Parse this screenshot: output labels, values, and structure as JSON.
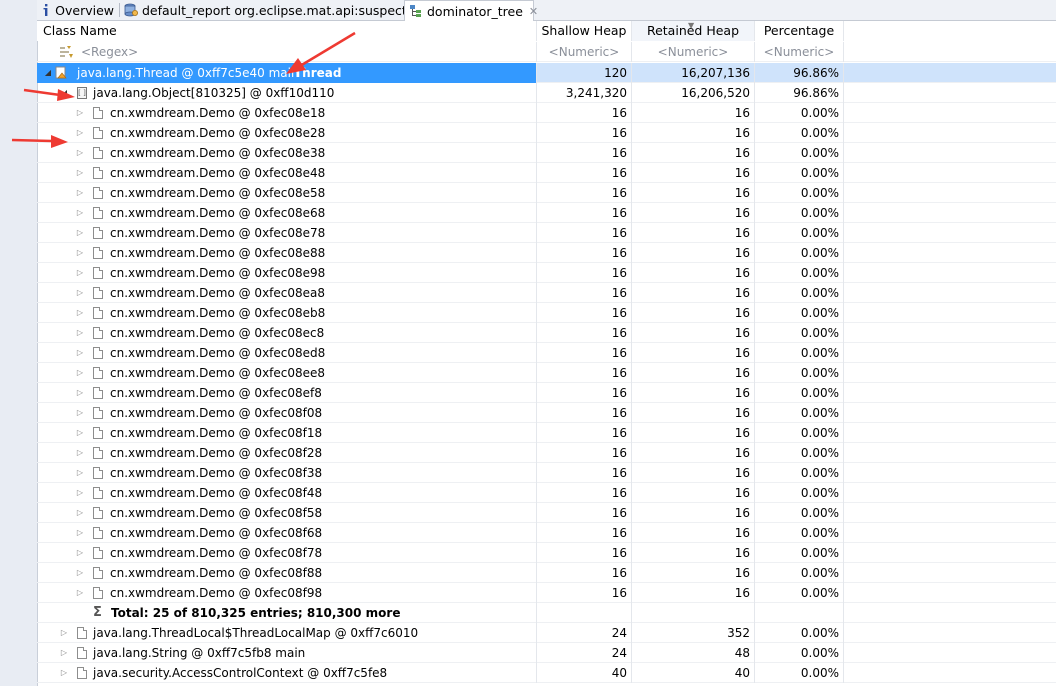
{
  "tabs": [
    {
      "icon": "info-icon",
      "label": "Overview"
    },
    {
      "icon": "report-icon",
      "label": "default_report  org.eclipse.mat.api:suspects"
    },
    {
      "icon": "tree-icon",
      "label": "dominator_tree",
      "active": true
    }
  ],
  "columns": {
    "class_name": "Class Name",
    "shallow": "Shallow Heap",
    "retained": "Retained Heap",
    "percentage": "Percentage"
  },
  "filter": {
    "class_name": "<Regex>",
    "shallow": "<Numeric>",
    "retained": "<Numeric>",
    "percentage": "<Numeric>"
  },
  "thread_row": {
    "name": "java.lang.Thread @ 0xff7c5e40  main",
    "suffix": "Thread",
    "shallow": "120",
    "retained": "16,207,136",
    "percentage": "96.86%"
  },
  "array_row": {
    "name": "java.lang.Object[810325] @ 0xff10d110",
    "shallow": "3,241,320",
    "retained": "16,206,520",
    "percentage": "96.86%"
  },
  "demo_rows": [
    {
      "name": "cn.xwmdream.Demo @ 0xfec08e18",
      "shallow": "16",
      "retained": "16",
      "percentage": "0.00%"
    },
    {
      "name": "cn.xwmdream.Demo @ 0xfec08e28",
      "shallow": "16",
      "retained": "16",
      "percentage": "0.00%"
    },
    {
      "name": "cn.xwmdream.Demo @ 0xfec08e38",
      "shallow": "16",
      "retained": "16",
      "percentage": "0.00%"
    },
    {
      "name": "cn.xwmdream.Demo @ 0xfec08e48",
      "shallow": "16",
      "retained": "16",
      "percentage": "0.00%"
    },
    {
      "name": "cn.xwmdream.Demo @ 0xfec08e58",
      "shallow": "16",
      "retained": "16",
      "percentage": "0.00%"
    },
    {
      "name": "cn.xwmdream.Demo @ 0xfec08e68",
      "shallow": "16",
      "retained": "16",
      "percentage": "0.00%"
    },
    {
      "name": "cn.xwmdream.Demo @ 0xfec08e78",
      "shallow": "16",
      "retained": "16",
      "percentage": "0.00%"
    },
    {
      "name": "cn.xwmdream.Demo @ 0xfec08e88",
      "shallow": "16",
      "retained": "16",
      "percentage": "0.00%"
    },
    {
      "name": "cn.xwmdream.Demo @ 0xfec08e98",
      "shallow": "16",
      "retained": "16",
      "percentage": "0.00%"
    },
    {
      "name": "cn.xwmdream.Demo @ 0xfec08ea8",
      "shallow": "16",
      "retained": "16",
      "percentage": "0.00%"
    },
    {
      "name": "cn.xwmdream.Demo @ 0xfec08eb8",
      "shallow": "16",
      "retained": "16",
      "percentage": "0.00%"
    },
    {
      "name": "cn.xwmdream.Demo @ 0xfec08ec8",
      "shallow": "16",
      "retained": "16",
      "percentage": "0.00%"
    },
    {
      "name": "cn.xwmdream.Demo @ 0xfec08ed8",
      "shallow": "16",
      "retained": "16",
      "percentage": "0.00%"
    },
    {
      "name": "cn.xwmdream.Demo @ 0xfec08ee8",
      "shallow": "16",
      "retained": "16",
      "percentage": "0.00%"
    },
    {
      "name": "cn.xwmdream.Demo @ 0xfec08ef8",
      "shallow": "16",
      "retained": "16",
      "percentage": "0.00%"
    },
    {
      "name": "cn.xwmdream.Demo @ 0xfec08f08",
      "shallow": "16",
      "retained": "16",
      "percentage": "0.00%"
    },
    {
      "name": "cn.xwmdream.Demo @ 0xfec08f18",
      "shallow": "16",
      "retained": "16",
      "percentage": "0.00%"
    },
    {
      "name": "cn.xwmdream.Demo @ 0xfec08f28",
      "shallow": "16",
      "retained": "16",
      "percentage": "0.00%"
    },
    {
      "name": "cn.xwmdream.Demo @ 0xfec08f38",
      "shallow": "16",
      "retained": "16",
      "percentage": "0.00%"
    },
    {
      "name": "cn.xwmdream.Demo @ 0xfec08f48",
      "shallow": "16",
      "retained": "16",
      "percentage": "0.00%"
    },
    {
      "name": "cn.xwmdream.Demo @ 0xfec08f58",
      "shallow": "16",
      "retained": "16",
      "percentage": "0.00%"
    },
    {
      "name": "cn.xwmdream.Demo @ 0xfec08f68",
      "shallow": "16",
      "retained": "16",
      "percentage": "0.00%"
    },
    {
      "name": "cn.xwmdream.Demo @ 0xfec08f78",
      "shallow": "16",
      "retained": "16",
      "percentage": "0.00%"
    },
    {
      "name": "cn.xwmdream.Demo @ 0xfec08f88",
      "shallow": "16",
      "retained": "16",
      "percentage": "0.00%"
    },
    {
      "name": "cn.xwmdream.Demo @ 0xfec08f98",
      "shallow": "16",
      "retained": "16",
      "percentage": "0.00%"
    }
  ],
  "total_row": {
    "text": "Total: 25 of 810,325 entries; 810,300 more"
  },
  "other_rows": [
    {
      "name": "java.lang.ThreadLocal$ThreadLocalMap @ 0xff7c6010",
      "shallow": "24",
      "retained": "352",
      "percentage": "0.00%"
    },
    {
      "name": "java.lang.String @ 0xff7c5fb8  main",
      "shallow": "24",
      "retained": "48",
      "percentage": "0.00%"
    },
    {
      "name": "java.security.AccessControlContext @ 0xff7c5fe8",
      "shallow": "40",
      "retained": "40",
      "percentage": "0.00%"
    }
  ],
  "colors": {
    "selection": "#3399ff",
    "annotation_arrow": "#ee3a32"
  }
}
